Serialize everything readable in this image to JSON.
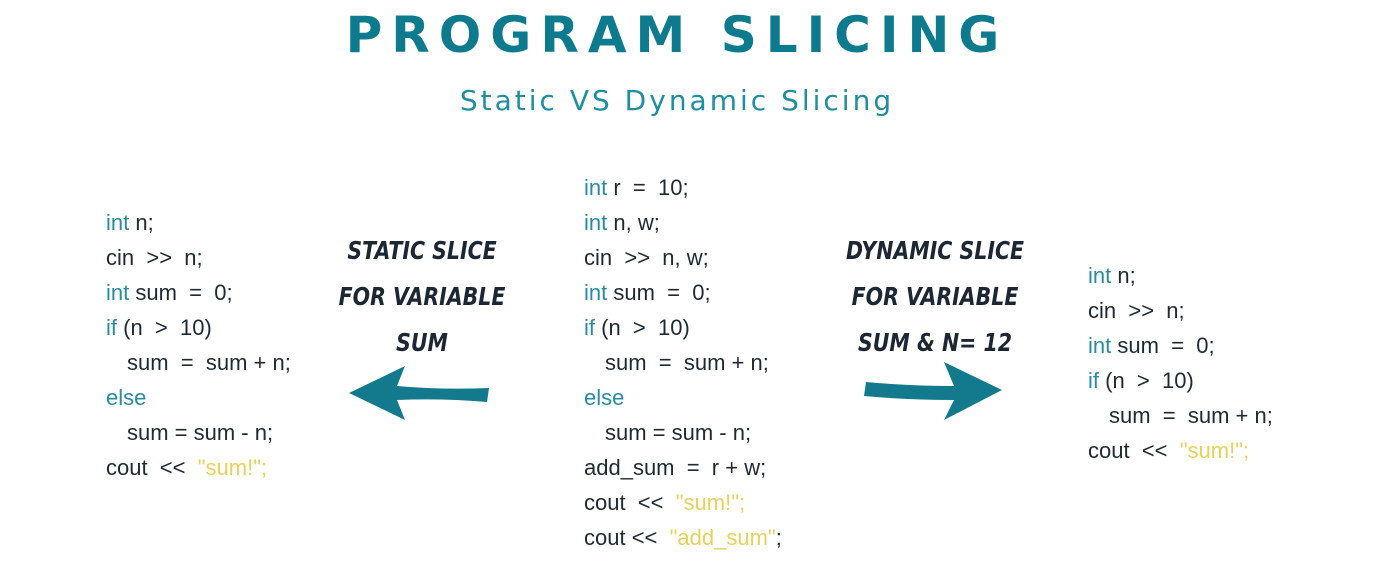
{
  "header": {
    "title": "PROGRAM SLICING",
    "subtitle": "Static VS Dynamic Slicing"
  },
  "colors": {
    "accent": "#0e7a8e",
    "keyword": "#2a8ba0",
    "string": "#e8d15a",
    "text": "#1e2a33"
  },
  "code_left": {
    "lines": [
      {
        "kw": "int",
        "text": " n;",
        "str": "",
        "tail": ""
      },
      {
        "kw": "",
        "text": "cin  >>  n;",
        "str": "",
        "tail": ""
      },
      {
        "kw": "int",
        "text": " sum  =  0;",
        "str": "",
        "tail": ""
      },
      {
        "kw": "if",
        "text": " (n  >  10)",
        "str": "",
        "tail": ""
      },
      {
        "kw": "",
        "text": "sum  =  sum + n;",
        "str": "",
        "tail": "",
        "indent": true
      },
      {
        "kw": "else",
        "text": "",
        "str": "",
        "tail": ""
      },
      {
        "kw": "",
        "text": "sum = sum - n;",
        "str": "",
        "tail": "",
        "indent": true
      },
      {
        "kw": "",
        "text": "cout  <<  ",
        "str": "\"sum!\";",
        "tail": ""
      }
    ]
  },
  "code_middle": {
    "lines": [
      {
        "kw": "int",
        "text": " r  =  10;",
        "str": "",
        "tail": ""
      },
      {
        "kw": "int",
        "text": " n, w;",
        "str": "",
        "tail": ""
      },
      {
        "kw": "",
        "text": "cin  >>  n, w;",
        "str": "",
        "tail": ""
      },
      {
        "kw": "int",
        "text": " sum  =  0;",
        "str": "",
        "tail": ""
      },
      {
        "kw": "if",
        "text": " (n  >  10)",
        "str": "",
        "tail": ""
      },
      {
        "kw": "",
        "text": "sum  =  sum + n;",
        "str": "",
        "tail": "",
        "indent": true
      },
      {
        "kw": "else",
        "text": "",
        "str": "",
        "tail": ""
      },
      {
        "kw": "",
        "text": "sum = sum - n;",
        "str": "",
        "tail": "",
        "indent": true
      },
      {
        "kw": "",
        "text": "add_sum  =  r + w;",
        "str": "",
        "tail": ""
      },
      {
        "kw": "",
        "text": "cout  <<  ",
        "str": "\"sum!\";",
        "tail": ""
      },
      {
        "kw": "",
        "text": "cout <<  ",
        "str": "\"add_sum\"",
        "tail": ";"
      }
    ]
  },
  "code_right": {
    "lines": [
      {
        "kw": "int",
        "text": " n;",
        "str": "",
        "tail": ""
      },
      {
        "kw": "",
        "text": "cin  >>  n;",
        "str": "",
        "tail": ""
      },
      {
        "kw": "int",
        "text": " sum  =  0;",
        "str": "",
        "tail": ""
      },
      {
        "kw": "if",
        "text": " (n  >  10)",
        "str": "",
        "tail": ""
      },
      {
        "kw": "",
        "text": "sum  =  sum + n;",
        "str": "",
        "tail": "",
        "indent": true
      },
      {
        "kw": "",
        "text": "cout  <<  ",
        "str": "\"sum!\";",
        "tail": ""
      }
    ]
  },
  "labels": {
    "static": {
      "lines": [
        "STATIC SLICE",
        "FOR VARIABLE",
        "SUM"
      ]
    },
    "dynamic": {
      "lines": [
        "DYNAMIC SLICE",
        "FOR VARIABLE",
        "SUM & N= 12"
      ]
    }
  },
  "icons": {
    "left_arrow": "arrow-left-icon",
    "right_arrow": "arrow-right-icon"
  }
}
